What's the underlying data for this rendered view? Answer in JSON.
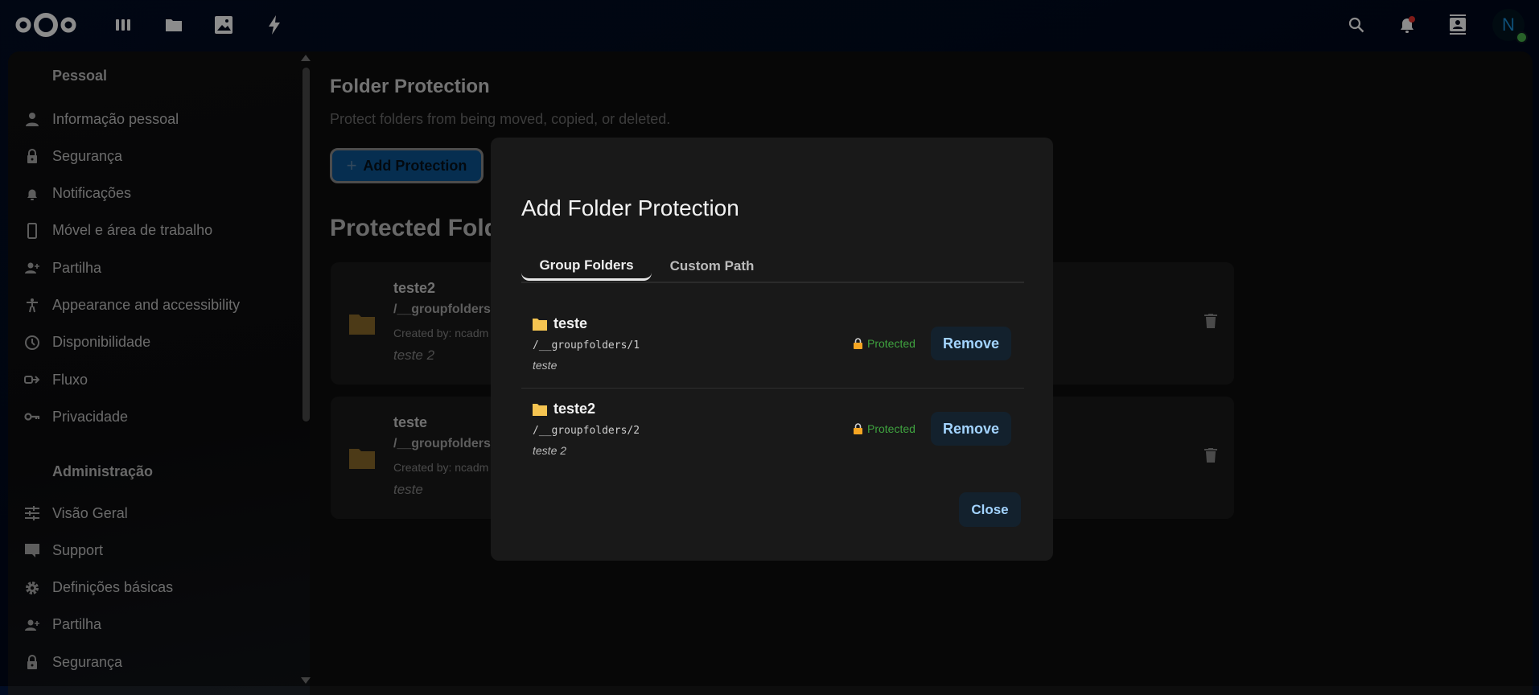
{
  "topbar": {
    "apps": [
      "dashboard-icon",
      "files-icon",
      "photos-icon",
      "activity-icon"
    ],
    "avatar_initial": "N",
    "notification_dot_color": "#e9322d",
    "status_color": "#49b34b"
  },
  "sidebar": {
    "personal_header": "Pessoal",
    "personal_items": [
      {
        "label": "Informação pessoal",
        "icon": "user-icon"
      },
      {
        "label": "Segurança",
        "icon": "lock-icon"
      },
      {
        "label": "Notificações",
        "icon": "bell-icon"
      },
      {
        "label": "Móvel e área de trabalho",
        "icon": "phone-icon"
      },
      {
        "label": "Partilha",
        "icon": "share-user-icon"
      },
      {
        "label": "Appearance and accessibility",
        "icon": "accessibility-icon"
      },
      {
        "label": "Disponibilidade",
        "icon": "clock-icon"
      },
      {
        "label": "Fluxo",
        "icon": "flow-icon"
      },
      {
        "label": "Privacidade",
        "icon": "key-icon"
      }
    ],
    "admin_header": "Administração",
    "admin_items": [
      {
        "label": "Visão Geral",
        "icon": "sliders-icon"
      },
      {
        "label": "Support",
        "icon": "chat-icon"
      },
      {
        "label": "Definições básicas",
        "icon": "gear-icon"
      },
      {
        "label": "Partilha",
        "icon": "share-user-icon"
      },
      {
        "label": "Segurança",
        "icon": "lock-icon"
      }
    ]
  },
  "main": {
    "title": "Folder Protection",
    "subtitle": "Protect folders from being moved, copied, or deleted.",
    "add_button": "Add Protection",
    "section_title": "Protected Fold",
    "cards": [
      {
        "name": "teste2",
        "path": "/__groupfolders",
        "created": "Created by: ncadm",
        "description": "teste 2"
      },
      {
        "name": "teste",
        "path": "/__groupfolders",
        "created": "Created by: ncadm",
        "description": "teste"
      }
    ]
  },
  "modal": {
    "title": "Add Folder Protection",
    "tabs": [
      {
        "label": "Group Folders",
        "active": true
      },
      {
        "label": "Custom Path",
        "active": false
      }
    ],
    "items": [
      {
        "name": "teste",
        "path": "/__groupfolders/1",
        "description": "teste",
        "status": "Protected",
        "action": "Remove"
      },
      {
        "name": "teste2",
        "path": "/__groupfolders/2",
        "description": "teste 2",
        "status": "Protected",
        "action": "Remove"
      }
    ],
    "close_label": "Close"
  }
}
